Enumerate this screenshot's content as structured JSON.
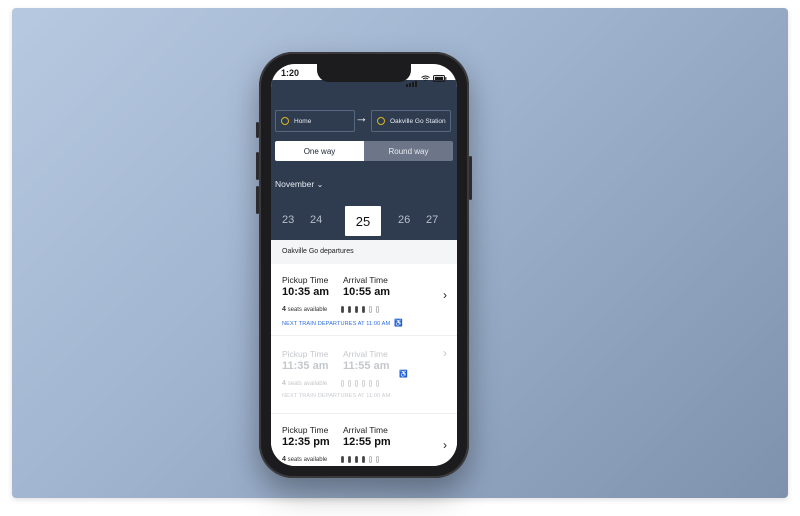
{
  "status": {
    "time": "1:20"
  },
  "route": {
    "from": "Home",
    "to": "Oakville Go Station"
  },
  "trip_type": {
    "one_way": "One way",
    "round_way": "Round way",
    "selected": "One way"
  },
  "calendar": {
    "month": "November",
    "dates": [
      "23",
      "24",
      "25",
      "26",
      "27"
    ],
    "selected": "25"
  },
  "section": {
    "title": "Oakville Go departures"
  },
  "departures": [
    {
      "pickup_label": "Pickup Time",
      "pickup_time": "10:35 am",
      "arrival_label": "Arrival Time",
      "arrival_time": "10:55 am",
      "seats_count": "4",
      "seats_text": "seats available",
      "next_train": "NEXT TRAIN DEPARTURES AT 11:00 AM",
      "available": true
    },
    {
      "pickup_label": "Pickup Time",
      "pickup_time": "11:35 am",
      "arrival_label": "Arrival Time",
      "arrival_time": "11:55 am",
      "seats_count": "4",
      "seats_text": "seats available",
      "next_train": "NEXT TRAIN DEPARTURES AT 11:00 AM",
      "available": false
    },
    {
      "pickup_label": "Pickup Time",
      "pickup_time": "12:35 pm",
      "arrival_label": "Arrival Time",
      "arrival_time": "12:55 pm",
      "seats_count": "4",
      "seats_text": "seats available",
      "next_train": "",
      "available": true
    }
  ],
  "colors": {
    "header_bg": "#2f3b4f",
    "accent": "#d8b520",
    "link": "#2d6fe0"
  }
}
